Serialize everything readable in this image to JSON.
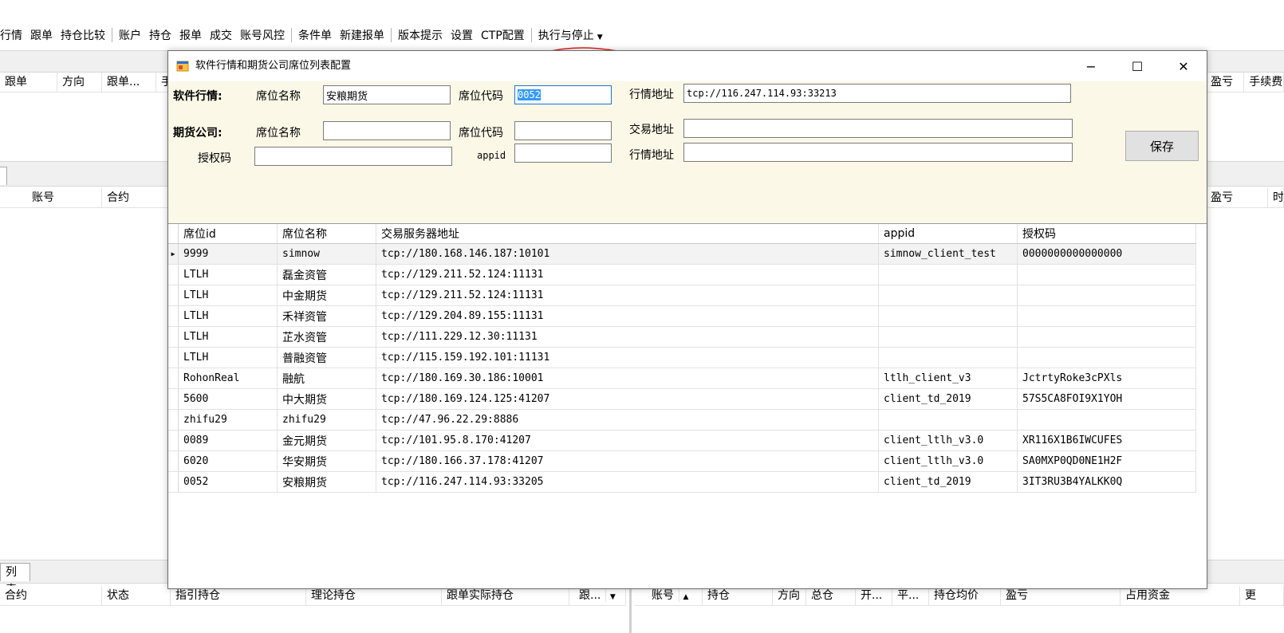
{
  "menubar": {
    "items": [
      "行情",
      "跟单",
      "持仓比较",
      "账户",
      "持仓",
      "报单",
      "成交",
      "账号风控",
      "条件单",
      "新建报单",
      "版本提示",
      "设置",
      "CTP配置",
      "执行与停止"
    ]
  },
  "background": {
    "top_grid_headers": [
      "跟单",
      "方向",
      "跟单...",
      "手"
    ],
    "top_grid_right_headers": [
      "盈亏",
      "手续费"
    ],
    "mid_grid_headers": [
      "账号",
      "合约"
    ],
    "mid_grid_right_headers": [
      "盈亏",
      "时"
    ],
    "bottom_tab": "列表",
    "bottom_left_headers": [
      "合约",
      "状态",
      "指引持仓",
      "理论持仓",
      "跟单实际持仓",
      "跟..."
    ],
    "bottom_right_headers": [
      "账号",
      "持仓",
      "方向",
      "总仓",
      "开...",
      "平...",
      "持仓均价",
      "盈亏",
      "占用资金",
      "更"
    ]
  },
  "dialog": {
    "title": "软件行情和期货公司席位列表配置",
    "minimize": "−",
    "maximize": "☐",
    "close": "✕",
    "software": {
      "section_label": "软件行情:",
      "seat_name_label": "席位名称",
      "seat_name_value": "安粮期货",
      "seat_code_label": "席位代码",
      "seat_code_value": "0052",
      "quote_addr_label": "行情地址",
      "quote_addr_value": "tcp://116.247.114.93:33213"
    },
    "broker": {
      "section_label": "期货公司:",
      "seat_name_label": "席位名称",
      "seat_name_value": "",
      "seat_code_label": "席位代码",
      "seat_code_value": "",
      "trade_addr_label": "交易地址",
      "trade_addr_value": "",
      "auth_label": "授权码",
      "auth_value": "",
      "appid_label": "appid",
      "appid_value": "",
      "quote_addr_label": "行情地址",
      "quote_addr_value": ""
    },
    "save_label": "保存",
    "grid": {
      "columns": [
        "席位id",
        "席位名称",
        "交易服务器地址",
        "appid",
        "授权码"
      ],
      "rows": [
        [
          "9999",
          "simnow",
          "tcp://180.168.146.187:10101",
          "simnow_client_test",
          "0000000000000000"
        ],
        [
          "LTLH",
          "磊金资管",
          "tcp://129.211.52.124:11131",
          "",
          ""
        ],
        [
          "LTLH",
          "中金期货",
          "tcp://129.211.52.124:11131",
          "",
          ""
        ],
        [
          "LTLH",
          "禾祥资管",
          "tcp://129.204.89.155:11131",
          "",
          ""
        ],
        [
          "LTLH",
          "芷水资管",
          "tcp://111.229.12.30:11131",
          "",
          ""
        ],
        [
          "LTLH",
          "普融资管",
          "tcp://115.159.192.101:11131",
          "",
          ""
        ],
        [
          "RohonReal",
          "融航",
          "tcp://180.169.30.186:10001",
          "ltlh_client_v3",
          "JctrtyRoke3cPXls"
        ],
        [
          "5600",
          "中大期货",
          "tcp://180.169.124.125:41207",
          "client_td_2019",
          "57S5CA8FOI9X1YOH"
        ],
        [
          "zhifu29",
          "zhifu29",
          "tcp://47.96.22.29:8886",
          "",
          ""
        ],
        [
          "0089",
          "金元期货",
          "tcp://101.95.8.170:41207",
          "client_ltlh_v3.0",
          "XR116X1B6IWCUFES"
        ],
        [
          "6020",
          "华安期货",
          "tcp://180.166.37.178:41207",
          "client_ltlh_v3.0",
          "SA0MXP0QD0NE1H2F"
        ],
        [
          "0052",
          "安粮期货",
          "tcp://116.247.114.93:33205",
          "client_td_2019",
          "3IT3RU3B4YALKK0Q"
        ]
      ]
    }
  }
}
